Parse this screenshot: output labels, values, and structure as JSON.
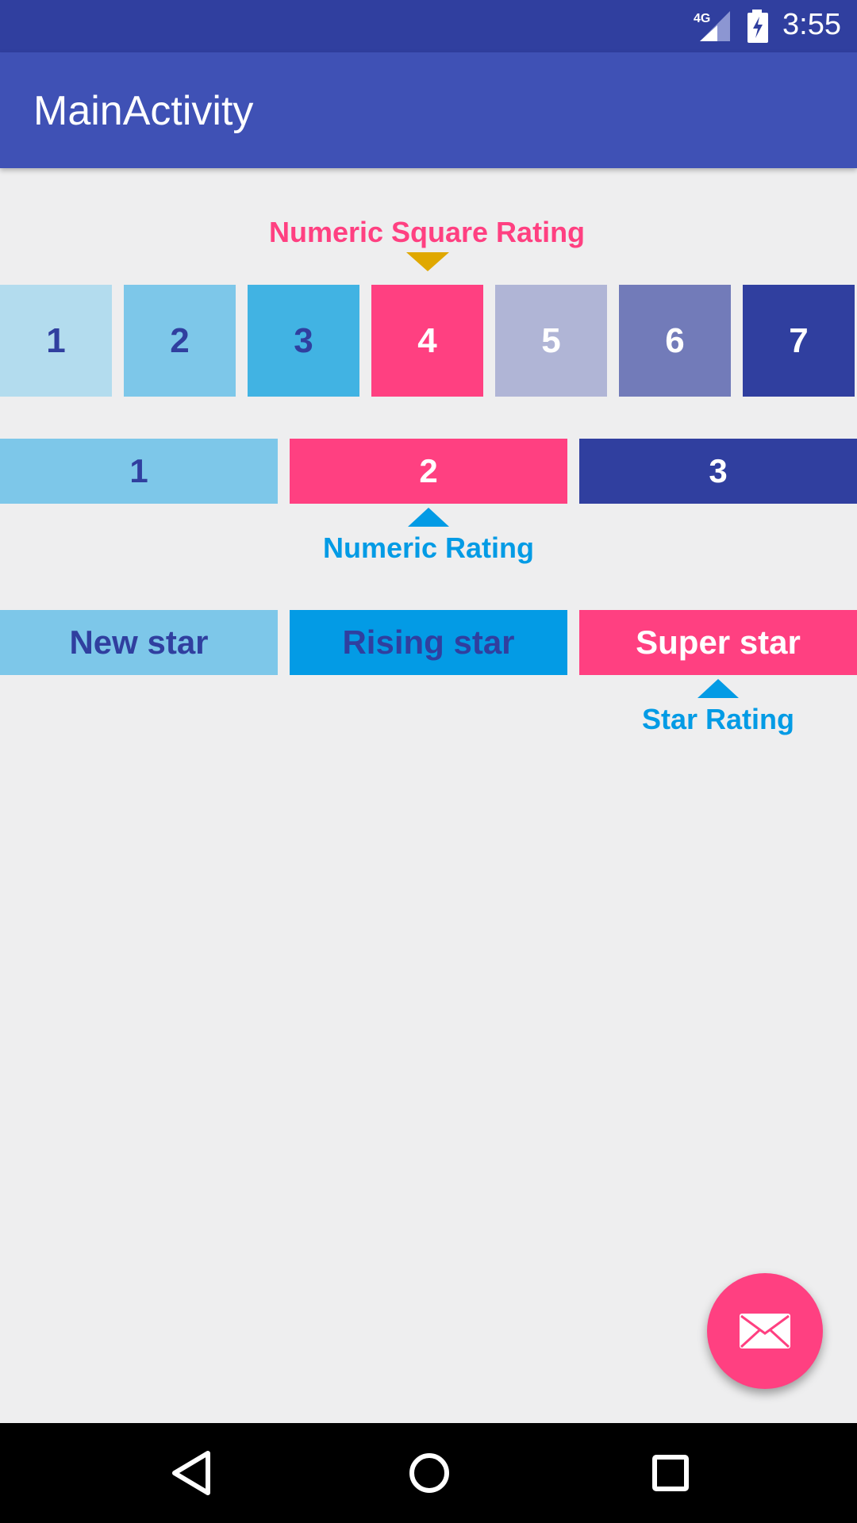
{
  "status_bar": {
    "network": "4G",
    "time": "3:55",
    "icons": [
      "signal-icon",
      "battery-charging-icon"
    ]
  },
  "app_bar": {
    "title": "MainActivity"
  },
  "numeric_square_rating": {
    "label": "Numeric Square Rating",
    "selected": "4",
    "items": [
      "1",
      "2",
      "3",
      "4",
      "5",
      "6",
      "7"
    ]
  },
  "numeric_rating": {
    "label": "Numeric Rating",
    "selected": "2",
    "items": [
      "1",
      "2",
      "3"
    ]
  },
  "star_rating": {
    "label": "Star Rating",
    "selected": "Super star",
    "items": [
      "New star",
      "Rising star",
      "Super star"
    ]
  },
  "fab": {
    "icon": "envelope-icon"
  },
  "nav_bar": {
    "icons": [
      "back-icon",
      "home-icon",
      "recents-icon"
    ]
  },
  "colors": {
    "status_bar": "#303f9f",
    "app_bar": "#3f51b5",
    "accent_pink": "#ff4081",
    "blue": "#039be5",
    "indigo_dark": "#303f9f",
    "gold": "#e0a800",
    "square_1": "#b3dcee",
    "square_2": "#7dc7e9",
    "square_3": "#41b3e3",
    "square_5": "#b0b5d6",
    "square_6": "#727bb9",
    "square_7": "#303f9f",
    "bar_light": "#7dc7e9"
  }
}
